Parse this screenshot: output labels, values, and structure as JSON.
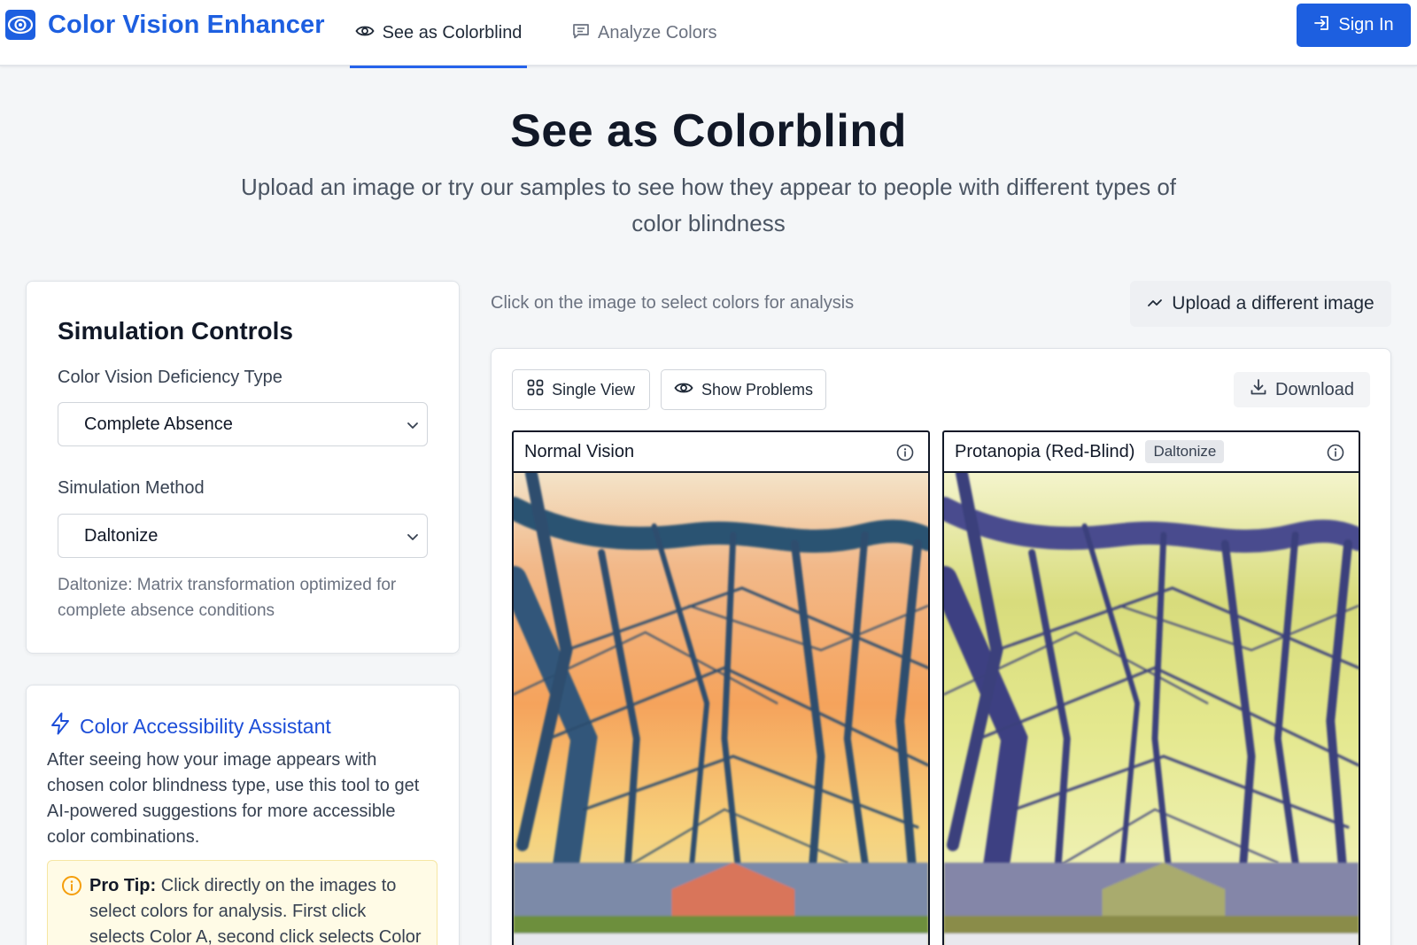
{
  "header": {
    "app_name": "Color Vision Enhancer",
    "tabs": [
      {
        "label": "See as Colorblind",
        "icon": "eye-icon",
        "active": true
      },
      {
        "label": "Analyze Colors",
        "icon": "message-square-icon",
        "active": false
      }
    ],
    "sign_in_label": "Sign In",
    "brand_color": "#1d5fe0"
  },
  "hero": {
    "title": "See as Colorblind",
    "subtitle": "Upload an image or try our samples to see how they appear to people with different types of color blindness"
  },
  "controls": {
    "title": "Simulation Controls",
    "deficiency_label": "Color Vision Deficiency Type",
    "deficiency_value": "Complete Absence",
    "method_label": "Simulation Method",
    "method_value": "Daltonize",
    "method_description": "Daltonize: Matrix transformation optimized for complete absence conditions"
  },
  "assistant": {
    "title": "Color Accessibility Assistant",
    "body": "After seeing how your image appears with chosen color blindness type, use this tool to get AI-powered suggestions for more accessible color combinations.",
    "tip_label": "Pro Tip:",
    "tip_text": "Click directly on the images to select colors for analysis. First click selects Color A, second click selects Color"
  },
  "viewer": {
    "hint": "Click on the image to select colors for analysis",
    "upload_label": "Upload a different image",
    "single_view_label": "Single View",
    "show_problems_label": "Show Problems",
    "download_label": "Download",
    "panels": [
      {
        "title": "Normal Vision",
        "badge": ""
      },
      {
        "title": "Protanopia (Red-Blind)",
        "badge": "Daltonize"
      }
    ]
  }
}
